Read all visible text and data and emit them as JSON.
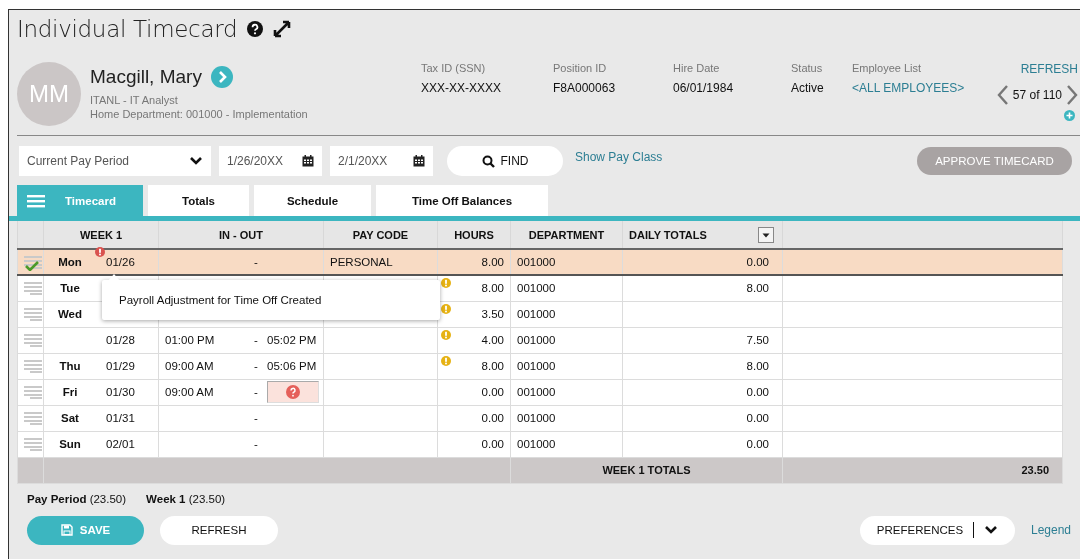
{
  "title": "Individual Timecard",
  "employee": {
    "initials": "MM",
    "name": "Macgill, Mary",
    "position": "ITANL - IT Analyst",
    "home_department": "Home Department: 001000 - Implementation"
  },
  "info_fields": [
    {
      "label": "Tax ID (SSN)",
      "value": "XXX-XX-XXXX",
      "kind": "text"
    },
    {
      "label": "Position ID",
      "value": "F8A000063",
      "kind": "text"
    },
    {
      "label": "Hire Date",
      "value": "06/01/1984",
      "kind": "text"
    },
    {
      "label": "Status",
      "value": "Active",
      "kind": "text"
    },
    {
      "label": "Employee List",
      "value": "<ALL EMPLOYEES>",
      "kind": "link"
    }
  ],
  "navigator": {
    "refresh": "REFRESH",
    "position": "57 of 110"
  },
  "filters": {
    "period": "Current Pay Period",
    "start_date": "1/26/20XX",
    "end_date": "2/1/20XX",
    "find": "FIND",
    "show_pay_class": "Show Pay Class",
    "approve": {
      "label": "APPROVE TIMECARD",
      "disabled": true
    }
  },
  "tabs": [
    {
      "label": "Timecard",
      "selected": true
    },
    {
      "label": "Totals",
      "selected": false
    },
    {
      "label": "Schedule",
      "selected": false
    },
    {
      "label": "Time Off Balances",
      "selected": false
    }
  ],
  "table": {
    "columns": [
      "WEEK 1",
      "IN - OUT",
      "PAY CODE",
      "HOURS",
      "DEPARTMENT",
      "DAILY TOTALS"
    ],
    "rows": [
      {
        "day": "Mon",
        "date": "01/26",
        "separator": "-",
        "pay_code": "PERSONAL",
        "hours": "8.00",
        "department": "001000",
        "daily_total": "0.00",
        "selected": true,
        "approved": true,
        "date_alert": true,
        "hours_warning": false,
        "out_missing": false
      },
      {
        "day": "Tue",
        "hours": "8.00",
        "department": "001000",
        "daily_total": "8.00",
        "selected": false,
        "approved": false,
        "date_alert": false,
        "hours_warning": true,
        "out_missing": false
      },
      {
        "day": "Wed",
        "hours": "3.50",
        "department": "001000",
        "selected": false,
        "approved": false,
        "date_alert": false,
        "hours_warning": true,
        "out_missing": false
      },
      {
        "date": "01/28",
        "in": "01:00 PM",
        "separator": "-",
        "out": "05:02 PM",
        "hours": "4.00",
        "department": "001000",
        "daily_total": "7.50",
        "selected": false,
        "approved": false,
        "date_alert": false,
        "hours_warning": true,
        "out_missing": false
      },
      {
        "day": "Thu",
        "date": "01/29",
        "in": "09:00 AM",
        "separator": "-",
        "out": "05:06 PM",
        "hours": "8.00",
        "department": "001000",
        "daily_total": "8.00",
        "selected": false,
        "approved": false,
        "date_alert": false,
        "hours_warning": true,
        "out_missing": false
      },
      {
        "day": "Fri",
        "date": "01/30",
        "in": "09:00 AM",
        "separator": "-",
        "hours": "0.00",
        "department": "001000",
        "daily_total": "0.00",
        "selected": false,
        "approved": false,
        "date_alert": false,
        "hours_warning": false,
        "out_missing": true
      },
      {
        "day": "Sat",
        "date": "01/31",
        "separator": "-",
        "hours": "0.00",
        "department": "001000",
        "daily_total": "0.00",
        "selected": false,
        "approved": false,
        "date_alert": false,
        "hours_warning": false,
        "out_missing": false
      },
      {
        "day": "Sun",
        "date": "02/01",
        "separator": "-",
        "hours": "0.00",
        "department": "001000",
        "daily_total": "0.00",
        "selected": false,
        "approved": false,
        "date_alert": false,
        "hours_warning": false,
        "out_missing": false
      }
    ],
    "totals": {
      "label": "WEEK 1 TOTALS",
      "value": "23.50"
    }
  },
  "tooltip": "Payroll Adjustment for Time Off Created",
  "summary": [
    {
      "label": "Pay Period",
      "value": "(23.50)"
    },
    {
      "label": "Week 1",
      "value": "(23.50)"
    }
  ],
  "buttons": {
    "save": "SAVE",
    "refresh": "REFRESH",
    "preferences": "PREFERENCES",
    "legend": "Legend"
  }
}
